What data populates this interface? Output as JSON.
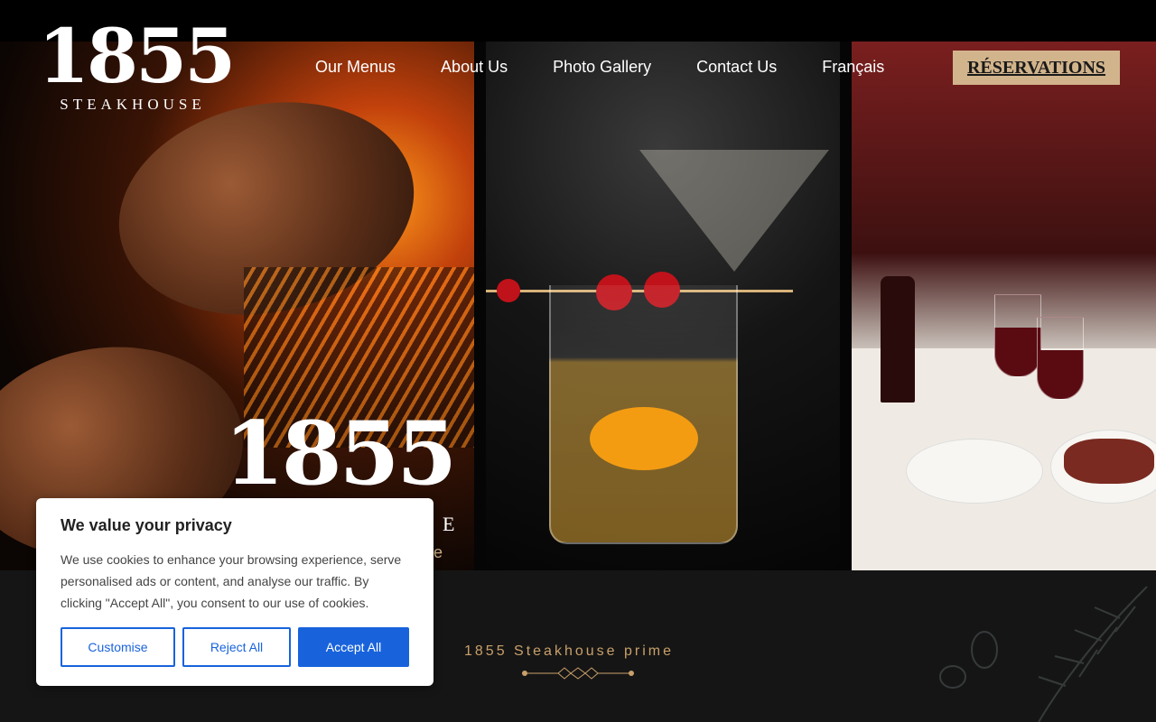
{
  "header": {
    "logo": {
      "number": "1855",
      "subtitle": "STEAKHOUSE"
    },
    "nav": [
      "Our Menus",
      "About Us",
      "Photo Gallery",
      "Contact Us",
      "Français"
    ],
    "reservations_label": "RÉSERVATIONS"
  },
  "hero": {
    "panel_logo_number": "1855",
    "panel_logo_partial": "E",
    "panel_logo_partial2": "e"
  },
  "tagline": "1855 Steakhouse prime",
  "cookie": {
    "title": "We value your privacy",
    "text": "We use cookies to enhance your browsing experience, serve personalised ads or content, and analyse our traffic. By clicking \"Accept All\", you consent to our use of cookies.",
    "customise": "Customise",
    "reject": "Reject All",
    "accept": "Accept All"
  },
  "colors": {
    "accent": "#d2b48c",
    "button_blue": "#1863dc",
    "tagline": "#c9a06a",
    "band": "#151515"
  }
}
